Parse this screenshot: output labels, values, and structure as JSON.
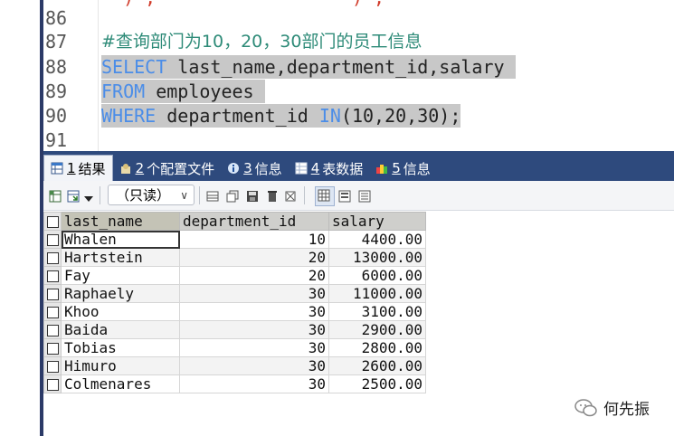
{
  "editor": {
    "top_partial": "  ) ,                  ) ,",
    "lines": [
      {
        "n": "86",
        "text": ""
      },
      {
        "n": "87",
        "comment": "#查询部门为10，20，30部门的员工信息"
      },
      {
        "n": "88",
        "kw": "SELECT",
        "rest": " last_name,department_id,salary "
      },
      {
        "n": "89",
        "kw": "FROM",
        "rest": " employees "
      },
      {
        "n": "90",
        "kw": "WHERE",
        "mid": " department_id ",
        "kw2": "IN",
        "rest": "(10,20,30);"
      },
      {
        "n": "91",
        "text": ""
      }
    ]
  },
  "tabs": [
    {
      "num": "1",
      "label": "结果",
      "icon": "result-grid-icon",
      "active": true
    },
    {
      "num": "2",
      "label": "个配置文件",
      "icon": "profile-icon",
      "active": false
    },
    {
      "num": "3",
      "label": "信息",
      "icon": "info-icon",
      "active": false
    },
    {
      "num": "4",
      "label": "表数据",
      "icon": "table-data-icon",
      "active": false
    },
    {
      "num": "5",
      "label": "信息",
      "icon": "info-colored-icon",
      "active": false
    }
  ],
  "toolbar": {
    "mode_select": "（只读）"
  },
  "results": {
    "columns": [
      "last_name",
      "department_id",
      "salary"
    ],
    "rows": [
      [
        "Whalen",
        "10",
        "4400.00"
      ],
      [
        "Hartstein",
        "20",
        "13000.00"
      ],
      [
        "Fay",
        "20",
        "6000.00"
      ],
      [
        "Raphaely",
        "30",
        "11000.00"
      ],
      [
        "Khoo",
        "30",
        "3100.00"
      ],
      [
        "Baida",
        "30",
        "2900.00"
      ],
      [
        "Tobias",
        "30",
        "2800.00"
      ],
      [
        "Himuro",
        "30",
        "2600.00"
      ],
      [
        "Colmenares",
        "30",
        "2500.00"
      ]
    ]
  },
  "watermark": {
    "text": "何先振"
  },
  "colors": {
    "keyword": "#4b8de8",
    "comment": "#2e8b78",
    "tabbar": "#2e4a7d"
  }
}
